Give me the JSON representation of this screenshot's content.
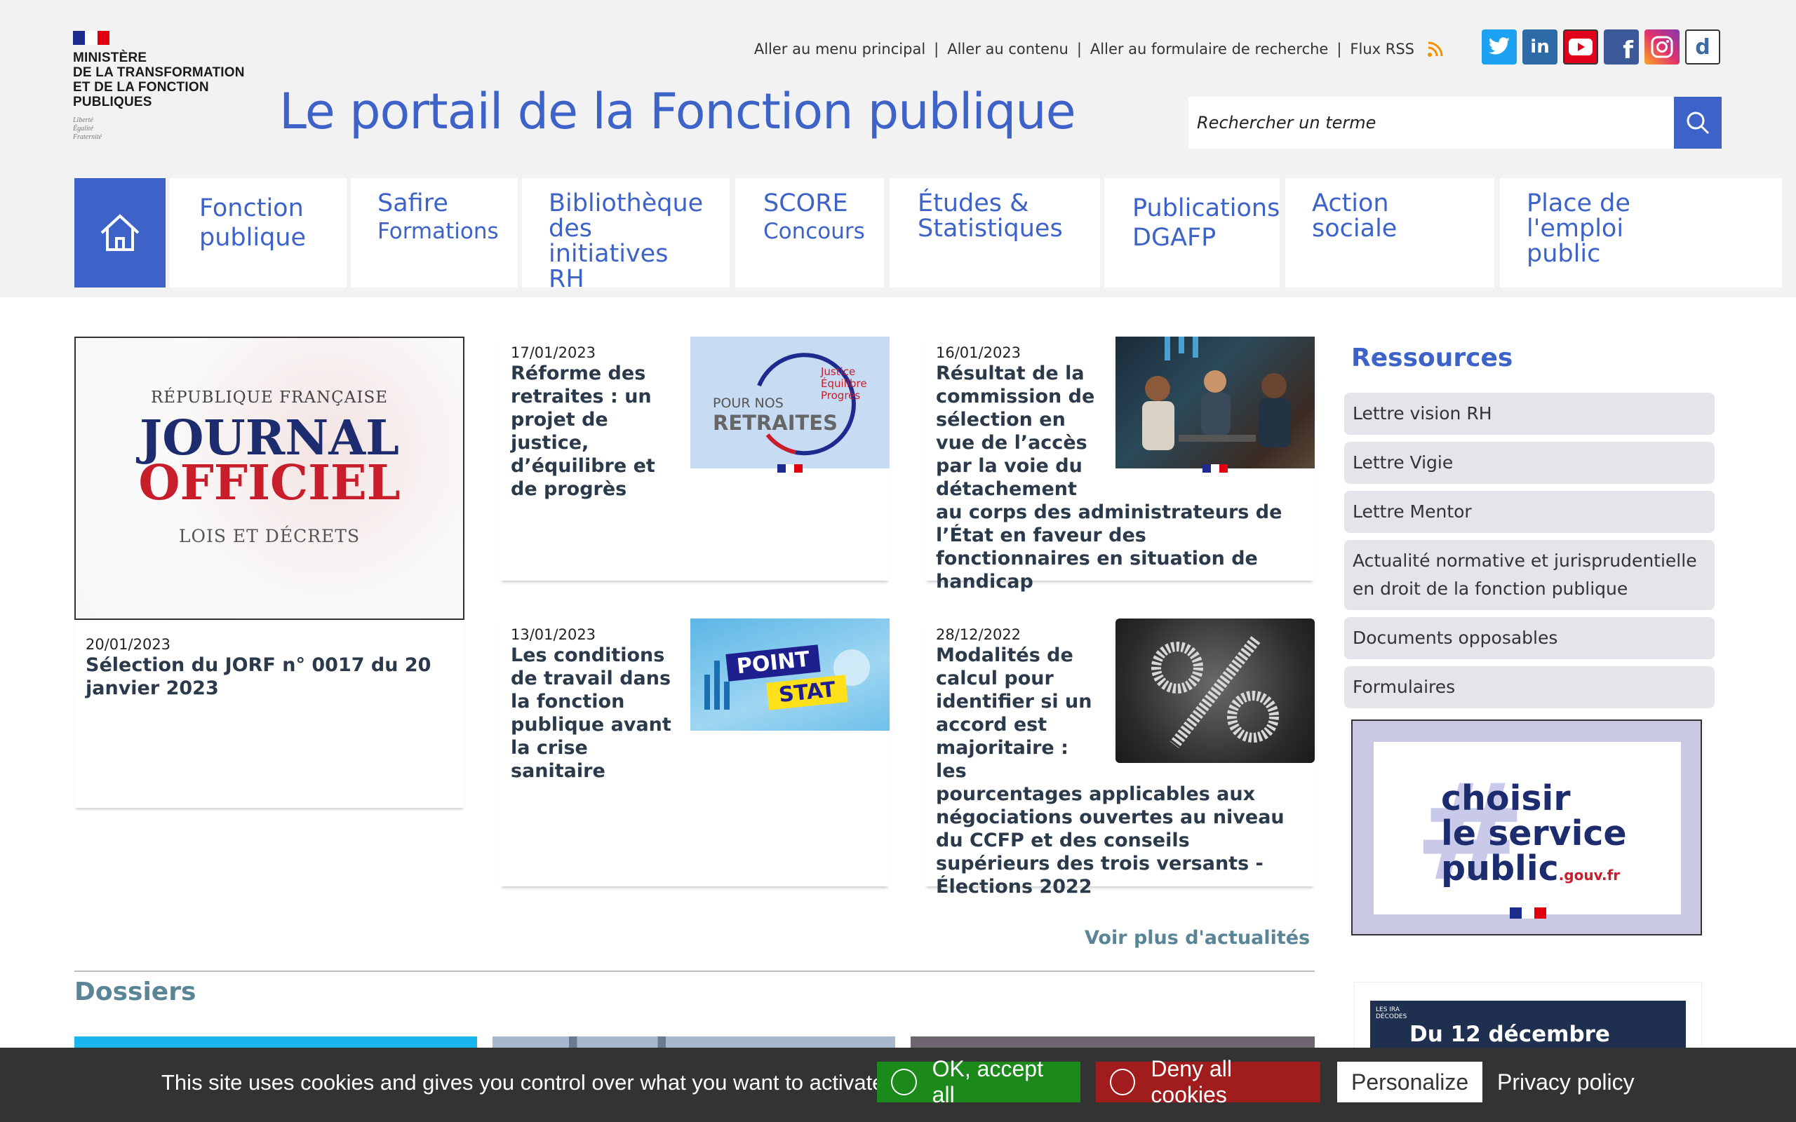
{
  "header": {
    "ministry_name": "MINISTÈRE\nDE LA TRANSFORMATION\nET DE LA FONCTION\nPUBLIQUES",
    "motto": "Liberté\nÉgalité\nFraternité",
    "site_title": "Le portail de la Fonction publique",
    "quick_links": [
      "Aller au menu principal",
      "Aller au contenu",
      "Aller au formulaire de recherche",
      "Flux RSS"
    ],
    "socials": [
      {
        "name": "twitter-icon",
        "color": "#1da1f2",
        "glyph": "t"
      },
      {
        "name": "linkedin-icon",
        "color": "#2d6aa7",
        "glyph": "in"
      },
      {
        "name": "youtube-icon",
        "color": "#e0001b",
        "glyph": "▶"
      },
      {
        "name": "facebook-icon",
        "color": "#3b5998",
        "glyph": "f"
      },
      {
        "name": "instagram-icon",
        "color": "#c13584",
        "glyph": "◎"
      },
      {
        "name": "dailymotion-icon",
        "color": "#ffffff",
        "glyph": "d"
      }
    ],
    "search_placeholder": "Rechercher un terme"
  },
  "nav": {
    "items": [
      {
        "l1": "Fonction\npublique",
        "l2": ""
      },
      {
        "l1": "Safire",
        "l2": "Formations"
      },
      {
        "l1": "Bibliothèque\ndes initiatives\nRH",
        "l2": ""
      },
      {
        "l1": "SCORE",
        "l2": "Concours"
      },
      {
        "l1": "Études &\nStatistiques",
        "l2": ""
      },
      {
        "l1": "Publications\nDGAFP",
        "l2": ""
      },
      {
        "l1": "Action\nsociale",
        "l2": ""
      },
      {
        "l1": "Place de\nl'emploi\npublic",
        "l2": ""
      }
    ]
  },
  "news": {
    "lead": {
      "date": "20/01/2023",
      "title": "Sélection du JORF n° 0017 du 20 janvier 2023",
      "img_l1": "RÉPUBLIQUE FRANÇAISE",
      "img_l2": "JOURNAL",
      "img_l3": "OFFICIEL",
      "img_l4": "LOIS ET DÉCRETS"
    },
    "items": [
      {
        "date": "17/01/2023",
        "title": "Réforme des retraites : un projet de justice, d’équilibre et de progrès",
        "img_a": "POUR NOS",
        "img_b": "RETRAITES",
        "img_c": "Justice\nÉquilibre\nProgrès"
      },
      {
        "date": "16/01/2023",
        "title": "Résultat de la commission de sélection en vue de l’accès par la voie du détachement au corps des administrateurs de l’État en faveur des fonctionnaires en situation de handicap"
      },
      {
        "date": "13/01/2023",
        "title": "Les conditions de travail dans la fonction publique avant la crise sanitaire",
        "img_a": "POINT",
        "img_b": "STAT"
      },
      {
        "date": "28/12/2022",
        "title": "Modalités de calcul pour identifier si un accord est majoritaire : les pourcentages applicables aux négociations ouvertes au niveau du CCFP et des conseils supérieurs des trois versants - Élections 2022"
      }
    ],
    "more": "Voir plus d'actualités"
  },
  "dossiers_title": "Dossiers",
  "sidebar": {
    "title": "Ressources",
    "items": [
      "Lettre vision RH",
      "Lettre Vigie",
      "Lettre Mentor",
      "Actualité normative et jurisprudentielle en droit de la fonction publique",
      "Documents opposables",
      "Formulaires"
    ],
    "promo": "choisir\nle service\npublic",
    "promo_suffix": ".gouv.fr",
    "event_badge": "LES IRA\nDÉCODES",
    "event_text": "Du 12 décembre"
  },
  "cookie": {
    "message": "This site uses cookies and gives you control over what you want to activate",
    "accept": "OK, accept all",
    "deny": "Deny all cookies",
    "personalize": "Personalize",
    "privacy": "Privacy policy"
  },
  "colors": {
    "brand_blue": "#3d63c8",
    "accept_green": "#1b8a1b",
    "deny_red": "#a11c1c",
    "teal": "#5a8597"
  }
}
